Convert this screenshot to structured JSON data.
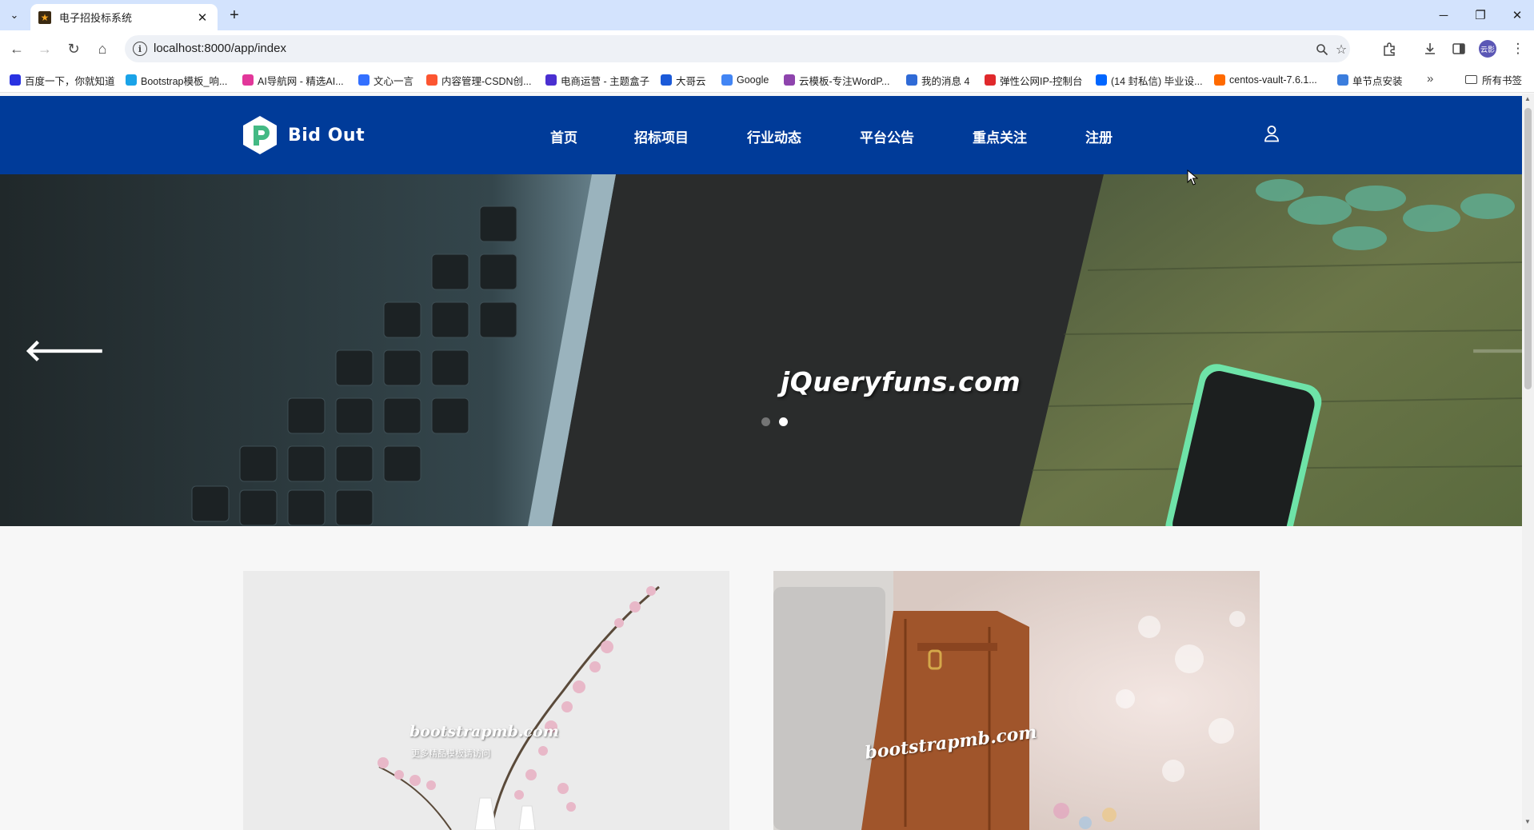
{
  "browser": {
    "tab_title": "电子招投标系统",
    "tab_favicon": "star-favicon-icon",
    "url": "localhost:8000/app/index",
    "profile_initials": "云影",
    "bookmarks": [
      {
        "label": "百度一下，你就知道",
        "icon": "baidu-icon",
        "color": "#2932e1"
      },
      {
        "label": "Bootstrap模板_响...",
        "icon": "bootstrap-icon",
        "color": "#1aa3e8"
      },
      {
        "label": "AI导航网 - 精选AI...",
        "icon": "ai-nav-icon",
        "color": "#e2379a"
      },
      {
        "label": "文心一言",
        "icon": "wenxin-icon",
        "color": "#3370ff"
      },
      {
        "label": "内容管理-CSDN创...",
        "icon": "csdn-icon",
        "color": "#fc5531"
      },
      {
        "label": "电商运营 - 主题盒子",
        "icon": "theme-box-icon",
        "color": "#4a2fd1"
      },
      {
        "label": "大哥云",
        "icon": "dage-cloud-icon",
        "color": "#1b5ad8"
      },
      {
        "label": "Google",
        "icon": "google-icon",
        "color": "#4285f4"
      },
      {
        "label": "云模板-专注WordP...",
        "icon": "yunmoban-icon",
        "color": "#8e44ad"
      },
      {
        "label": "我的消息 4",
        "icon": "bilibili-icon",
        "color": "#2f6ad6"
      },
      {
        "label": "弹性公网IP-控制台",
        "icon": "huawei-cloud-icon",
        "color": "#e0292c"
      },
      {
        "label": "(14 封私信) 毕业设...",
        "icon": "zhihu-icon",
        "color": "#0066ff"
      },
      {
        "label": "centos-vault-7.6.1...",
        "icon": "aliyun-icon",
        "color": "#ff6a00"
      },
      {
        "label": "单节点安装",
        "icon": "layers-icon",
        "color": "#3b7ddd"
      }
    ],
    "all_bookmarks_label": "所有书签"
  },
  "site": {
    "brand": "Bid Out",
    "nav": [
      "首页",
      "招标项目",
      "行业动态",
      "平台公告",
      "重点关注",
      "注册"
    ],
    "colors": {
      "header": "#003b99",
      "accent": "#43b984"
    }
  },
  "hero": {
    "watermark": "jQueryfuns.com",
    "slide_count": 2,
    "active_slide": 2
  },
  "cards": [
    {
      "watermark": "bootstrapmb.com",
      "sub": "更多精品模板请访问"
    },
    {
      "watermark": "bootstrapmb.com"
    }
  ]
}
